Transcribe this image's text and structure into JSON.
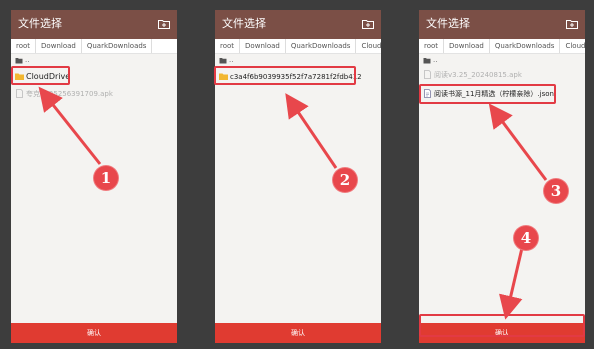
{
  "colors": {
    "titlebar": "#7b4f46",
    "confirm": "#e03b31",
    "highlight": "#e23a44",
    "background": "#3d3d3d"
  },
  "panel1": {
    "title": "文件选择",
    "breadcrumbs": [
      "root",
      "Download",
      "QuarkDownloads"
    ],
    "up_label": "..",
    "items": [
      {
        "name": "CloudDrive",
        "icon": "folder-icon"
      },
      {
        "name": "夸克17252563917​09.apk",
        "icon": "file-icon"
      }
    ],
    "confirm_label": "确认",
    "step": "1"
  },
  "panel2": {
    "title": "文件选择",
    "breadcrumbs": [
      "root",
      "Download",
      "QuarkDownloads",
      "CloudDri"
    ],
    "up_label": "..",
    "items": [
      {
        "name": "c3a4f6b9039935f52f7a7281f2fdb412",
        "icon": "folder-icon"
      }
    ],
    "confirm_label": "确认",
    "step": "2"
  },
  "panel3": {
    "title": "文件选择",
    "breadcrumbs": [
      "root",
      "Download",
      "QuarkDownloads",
      "CloudDri"
    ],
    "up_label": "..",
    "items": [
      {
        "name": "阅读v3.25_20240815.apk",
        "icon": "file-icon"
      },
      {
        "name": "阅读书源_11月精选（柠檬亲除）.json",
        "icon": "file-icon"
      }
    ],
    "confirm_label": "确认",
    "step_select": "3",
    "step_confirm": "4"
  }
}
